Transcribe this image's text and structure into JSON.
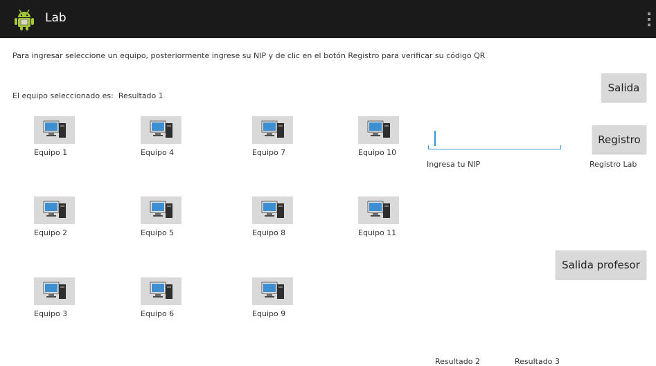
{
  "app": {
    "title": "Lab"
  },
  "instructions": "Para ingresar seleccione un equipo, posteriormente ingrese su NIP y de clic en el botón Registro para verificar su código QR",
  "selection": {
    "label": "El equipo seleccionado es:",
    "value": "Resultado 1"
  },
  "buttons": {
    "salida": "Salida",
    "registro": "Registro",
    "salida_profesor": "Salida profesor"
  },
  "nip": {
    "value": "",
    "label": "Ingresa tu NIP"
  },
  "registro_lab_label": "Registro Lab",
  "results": {
    "resultado2": "Resultado 2",
    "resultado3": "Resultado 3"
  },
  "equipos": [
    {
      "label": "Equipo 1",
      "icon": "computer-icon"
    },
    {
      "label": "Equipo 4",
      "icon": "computer-icon"
    },
    {
      "label": "Equipo 7",
      "icon": "computer-icon"
    },
    {
      "label": "Equipo 10",
      "icon": "computer-icon"
    },
    {
      "label": "Equipo 2",
      "icon": "computer-icon"
    },
    {
      "label": "Equipo 5",
      "icon": "computer-icon"
    },
    {
      "label": "Equipo 8",
      "icon": "computer-icon"
    },
    {
      "label": "Equipo 11",
      "icon": "computer-icon"
    },
    {
      "label": "Equipo 3",
      "icon": "computer-icon"
    },
    {
      "label": "Equipo 6",
      "icon": "computer-icon"
    },
    {
      "label": "Equipo 9",
      "icon": "computer-icon"
    }
  ],
  "colors": {
    "action_bar": "#1a1a1a",
    "accent": "#2d9ad4",
    "button": "#d9d9d9",
    "android_green": "#a4c639"
  }
}
